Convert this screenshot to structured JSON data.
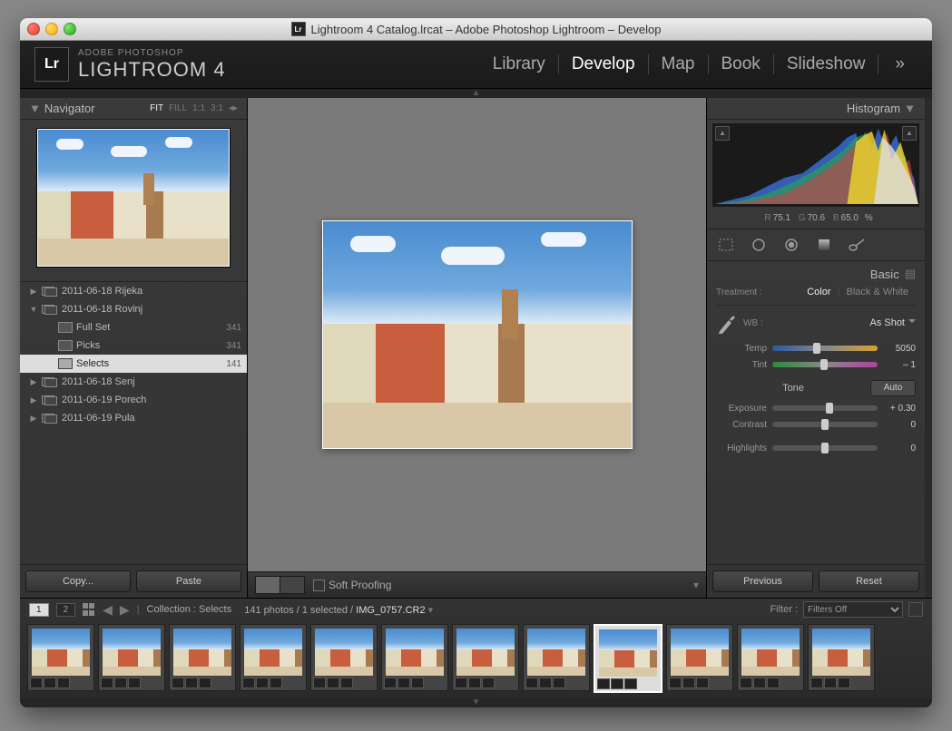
{
  "window_title": "Lightroom 4 Catalog.lrcat – Adobe Photoshop Lightroom – Develop",
  "brand": {
    "top": "ADOBE PHOTOSHOP",
    "name": "LIGHTROOM 4",
    "logo": "Lr"
  },
  "modules": [
    "Library",
    "Develop",
    "Map",
    "Book",
    "Slideshow"
  ],
  "active_module": "Develop",
  "navigator": {
    "title": "Navigator",
    "zoom_opts": [
      "FIT",
      "FILL",
      "1:1",
      "3:1"
    ],
    "zoom_active": "FIT"
  },
  "folders": [
    {
      "level": 0,
      "expand": "▶",
      "name": "2011-06-18 Rijeka",
      "count": ""
    },
    {
      "level": 0,
      "expand": "▼",
      "name": "2011-06-18 Rovinj",
      "count": ""
    },
    {
      "level": 1,
      "expand": "",
      "name": "Full Set",
      "count": "341"
    },
    {
      "level": 1,
      "expand": "",
      "name": "Picks",
      "count": "341"
    },
    {
      "level": 1,
      "expand": "",
      "name": "Selects",
      "count": "141",
      "selected": true
    },
    {
      "level": 0,
      "expand": "▶",
      "name": "2011-06-18 Senj",
      "count": ""
    },
    {
      "level": 0,
      "expand": "▶",
      "name": "2011-06-19 Porech",
      "count": ""
    },
    {
      "level": 0,
      "expand": "▶",
      "name": "2011-06-19 Pula",
      "count": ""
    }
  ],
  "left_buttons": {
    "copy": "Copy...",
    "paste": "Paste"
  },
  "center_toolbar": {
    "soft_proof": "Soft Proofing"
  },
  "right_buttons": {
    "prev": "Previous",
    "reset": "Reset"
  },
  "histogram": {
    "title": "Histogram",
    "rgb": {
      "r": "75.1",
      "g": "70.6",
      "b": "65.0",
      "pct": "%"
    }
  },
  "basic": {
    "title": "Basic",
    "treatment_label": "Treatment :",
    "treatment_opts": [
      "Color",
      "Black & White"
    ],
    "treatment_active": "Color",
    "wb_label": "WB :",
    "wb_value": "As Shot",
    "temp": {
      "label": "Temp",
      "value": "5050",
      "pos": 42
    },
    "tint": {
      "label": "Tint",
      "value": "– 1",
      "pos": 49
    },
    "tone_label": "Tone",
    "auto": "Auto",
    "exposure": {
      "label": "Exposure",
      "value": "+ 0.30",
      "pos": 54
    },
    "contrast": {
      "label": "Contrast",
      "value": "0",
      "pos": 50
    },
    "highlights": {
      "label": "Highlights",
      "value": "0",
      "pos": 50
    }
  },
  "footer": {
    "collection_label": "Collection :",
    "collection_name": "Selects",
    "count_text": "141 photos / 1 selected /",
    "filename": "IMG_0757.CR2",
    "filter_label": "Filter :",
    "filter_value": "Filters Off"
  }
}
